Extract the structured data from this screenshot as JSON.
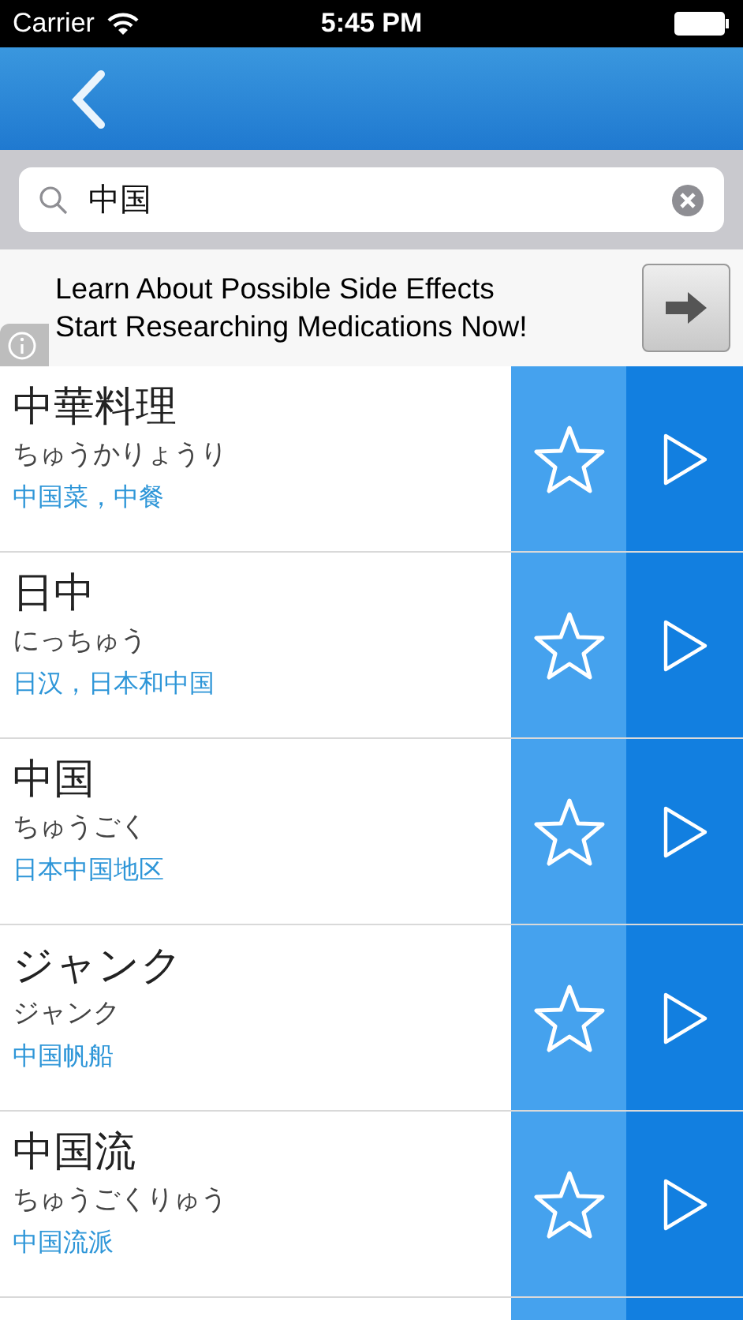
{
  "status_bar": {
    "carrier": "Carrier",
    "time": "5:45 PM"
  },
  "search": {
    "value": "中国"
  },
  "ad": {
    "lines": [
      "Learn About Possible Side Effects",
      "Start Researching Medications Now!"
    ]
  },
  "results": [
    {
      "word": "中華料理",
      "reading": "ちゅうかりょうり",
      "meaning": "中国菜，中餐",
      "favorite": false
    },
    {
      "word": "日中",
      "reading": "にっちゅう",
      "meaning": "日汉，日本和中国",
      "favorite": false
    },
    {
      "word": "中国",
      "reading": "ちゅうごく",
      "meaning": "日本中国地区",
      "favorite": false
    },
    {
      "word": "ジャンク",
      "reading": "ジャンク",
      "meaning": "中国帆船",
      "favorite": false
    },
    {
      "word": "中国流",
      "reading": "ちゅうごくりゅう",
      "meaning": "中国流派",
      "favorite": false
    }
  ]
}
